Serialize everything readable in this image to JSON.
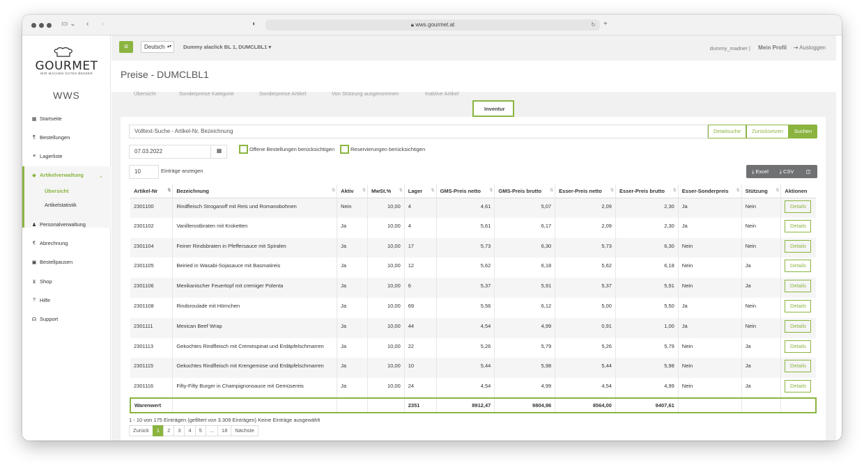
{
  "browser": {
    "url": "wws.gourmet.at"
  },
  "brand": {
    "logo": "GOURMET",
    "tagline": "WIR MACHEN GUTES BESSER",
    "app_name": "WWS"
  },
  "sidebar": {
    "items": [
      {
        "label": "Startseite",
        "icon": "dashboard-icon"
      },
      {
        "label": "Bestellungen",
        "icon": "cutlery-icon"
      },
      {
        "label": "Lagerliste",
        "icon": "list-icon"
      },
      {
        "label": "Artikelverwaltung",
        "icon": "tags-icon"
      },
      {
        "label": "Personalverwaltung",
        "icon": "users-icon"
      },
      {
        "label": "Abrechnung",
        "icon": "euro-icon"
      },
      {
        "label": "Bestellpausen",
        "icon": "calendar-icon"
      },
      {
        "label": "Shop",
        "icon": "cart-icon"
      },
      {
        "label": "Hilfe",
        "icon": "question-icon"
      },
      {
        "label": "Support",
        "icon": "headset-icon"
      }
    ],
    "sub_items": [
      "Übersicht",
      "Artikelstatistik"
    ]
  },
  "header": {
    "language": "Deutsch",
    "client": "Dummy alaclick BL 1, DUMCLBL1",
    "user": "dummy_madner |",
    "profile": "Mein Profil",
    "logout": "Ausloggen"
  },
  "page": {
    "title": "Preise - DUMCLBL1"
  },
  "tabs": [
    "Übersicht",
    "Sonderpreise Kategorie",
    "Sonderpreise Artikel",
    "Von Stützung ausgenommen",
    "Inaktive Artikel",
    "Inventur"
  ],
  "filters": {
    "search_placeholder": "Volltext-Suche - Artikel-Nr, Bezeichnung",
    "detail_search": "Detailsuche",
    "reset": "Zurücksetzen",
    "search": "Suchen",
    "date": "07.03.2022",
    "open_orders": "Offene Bestellungen berücksichtigen",
    "reservations": "Reservierungen berücksichtigen",
    "page_length": "10",
    "page_length_label": "Einträge anzeigen",
    "excel": "Excel",
    "csv": "CSV"
  },
  "table": {
    "columns": [
      "Artikel-Nr",
      "Bezeichnung",
      "Aktiv",
      "MwSt.%",
      "Lager",
      "GMS-Preis netto",
      "GMS-Preis brutto",
      "Esser-Preis netto",
      "Esser-Preis brutto",
      "Esser-Sonderpreis",
      "Stützung",
      "Aktionen"
    ],
    "action_label": "Details",
    "rows": [
      [
        "2301100",
        "Rindfleisch Stroganoff mit Reis und Romanobohnen",
        "Nein",
        "10,00",
        "4",
        "4,61",
        "5,07",
        "2,09",
        "2,30",
        "Ja",
        "Nein"
      ],
      [
        "2301102",
        "Vanillerostbraten mit Kroketten",
        "Ja",
        "10,00",
        "4",
        "5,61",
        "6,17",
        "2,09",
        "2,30",
        "Ja",
        "Nein"
      ],
      [
        "2301104",
        "Feiner Rindsbraten in Pfeffersauce mit Spiralen",
        "Ja",
        "10,00",
        "17",
        "5,73",
        "6,30",
        "5,73",
        "6,30",
        "Nein",
        "Nein"
      ],
      [
        "2301105",
        "Beiried in Wasabi-Sojasauce mit Basmatireis",
        "Ja",
        "10,00",
        "12",
        "5,62",
        "6,18",
        "5,62",
        "6,18",
        "Nein",
        "Ja"
      ],
      [
        "2301106",
        "Mexikanischer Feuertopf mit cremiger Polenta",
        "Ja",
        "10,00",
        "6",
        "5,37",
        "5,91",
        "5,37",
        "5,91",
        "Nein",
        "Ja"
      ],
      [
        "2301108",
        "Rindsroulade mit Hörnchen",
        "Ja",
        "10,00",
        "69",
        "5,56",
        "6,12",
        "5,00",
        "5,50",
        "Ja",
        "Nein"
      ],
      [
        "2301111",
        "Mexican Beef Wrap",
        "Ja",
        "10,00",
        "44",
        "4,54",
        "4,99",
        "0,91",
        "1,00",
        "Ja",
        "Nein"
      ],
      [
        "2301113",
        "Gekochtes Rindfleisch mit Cremespinat und Erdäpfelschmarren",
        "Ja",
        "10,00",
        "22",
        "5,26",
        "5,79",
        "5,26",
        "5,79",
        "Nein",
        "Ja"
      ],
      [
        "2301115",
        "Gekochtes Rindfleisch mit Krengemüse und Erdäpfelschmarren",
        "Ja",
        "10,00",
        "10",
        "5,44",
        "5,98",
        "5,44",
        "5,98",
        "Nein",
        "Ja"
      ],
      [
        "2301116",
        "Fifty-Fifty Burger in Champignonsauce mit Gemüsereis",
        "Ja",
        "10,00",
        "24",
        "4,54",
        "4,99",
        "4,54",
        "4,99",
        "Nein",
        "Ja"
      ]
    ],
    "total": {
      "label": "Warenwert",
      "lager": "2351",
      "gms_netto": "8912,47",
      "gms_brutto": "9804,96",
      "esser_netto": "8564,00",
      "esser_brutto": "9407,61"
    }
  },
  "footer": {
    "info": "1 - 10 von 175 Einträgen (gefiltert von 3.309 Einträgen)   Keine Einträge ausgewählt",
    "pagination": [
      "Zurück",
      "1",
      "2",
      "3",
      "4",
      "5",
      "...",
      "18",
      "Nächste"
    ]
  },
  "colors": {
    "accent": "#8ab43f",
    "export_bg": "#6f7173"
  }
}
